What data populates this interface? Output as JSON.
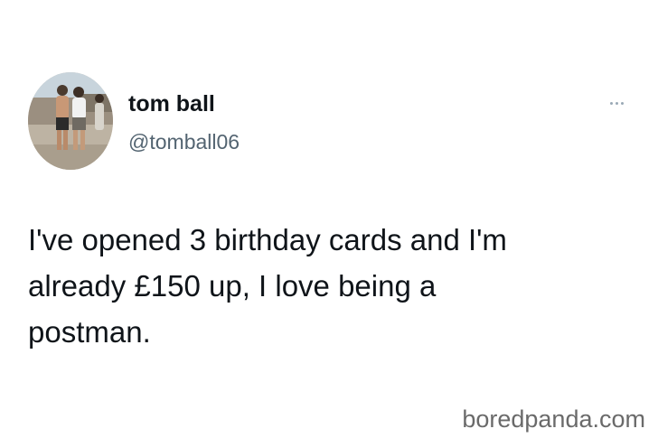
{
  "tweet": {
    "author": {
      "display_name": "tom ball",
      "handle": "@tomball06",
      "avatar_icon": "profile-photo"
    },
    "more_icon": "more-horizontal-icon",
    "text": "I've opened 3 birthday cards and I'm\nalready £150 up, I love being a\npostman."
  },
  "watermark": {
    "text": "boredpanda.com"
  },
  "colors": {
    "text_primary": "#0f1419",
    "text_secondary": "#536471",
    "watermark": "#6a6a6a",
    "background": "#ffffff"
  }
}
